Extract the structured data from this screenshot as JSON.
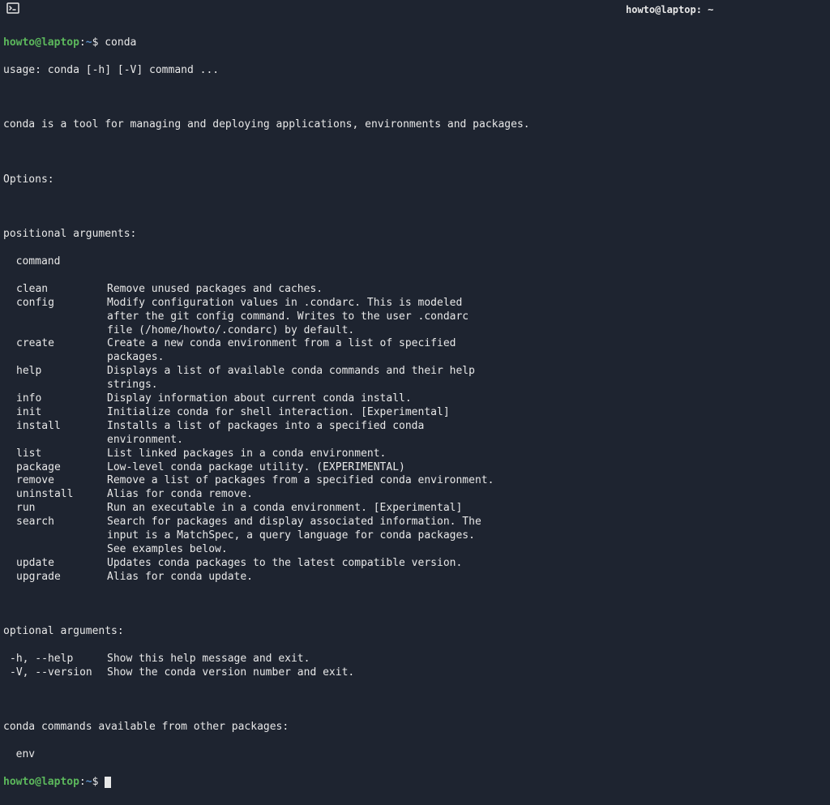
{
  "titlebar": {
    "title": "howto@laptop: ~"
  },
  "prompt": {
    "user_host": "howto@laptop",
    "separator": ":",
    "path": "~",
    "dollar": "$"
  },
  "command1": "conda",
  "usage": "usage: conda [-h] [-V] command ...",
  "description": "conda is a tool for managing and deploying applications, environments and packages.",
  "options_header": "Options:",
  "positional_header": "positional arguments:",
  "command_label": "  command",
  "positional_args": [
    {
      "name": "clean",
      "desc": [
        "Remove unused packages and caches."
      ]
    },
    {
      "name": "config",
      "desc": [
        "Modify configuration values in .condarc. This is modeled",
        "after the git config command. Writes to the user .condarc",
        "file (/home/howto/.condarc) by default."
      ]
    },
    {
      "name": "create",
      "desc": [
        "Create a new conda environment from a list of specified",
        "packages."
      ]
    },
    {
      "name": "help",
      "desc": [
        "Displays a list of available conda commands and their help",
        "strings."
      ]
    },
    {
      "name": "info",
      "desc": [
        "Display information about current conda install."
      ]
    },
    {
      "name": "init",
      "desc": [
        "Initialize conda for shell interaction. [Experimental]"
      ]
    },
    {
      "name": "install",
      "desc": [
        "Installs a list of packages into a specified conda",
        "environment."
      ]
    },
    {
      "name": "list",
      "desc": [
        "List linked packages in a conda environment."
      ]
    },
    {
      "name": "package",
      "desc": [
        "Low-level conda package utility. (EXPERIMENTAL)"
      ]
    },
    {
      "name": "remove",
      "desc": [
        "Remove a list of packages from a specified conda environment."
      ]
    },
    {
      "name": "uninstall",
      "desc": [
        "Alias for conda remove."
      ]
    },
    {
      "name": "run",
      "desc": [
        "Run an executable in a conda environment. [Experimental]"
      ]
    },
    {
      "name": "search",
      "desc": [
        "Search for packages and display associated information. The",
        "input is a MatchSpec, a query language for conda packages.",
        "See examples below."
      ]
    },
    {
      "name": "update",
      "desc": [
        "Updates conda packages to the latest compatible version."
      ]
    },
    {
      "name": "upgrade",
      "desc": [
        "Alias for conda update."
      ]
    }
  ],
  "optional_header": "optional arguments:",
  "optional_args": [
    {
      "name": "-h, --help",
      "desc": "Show this help message and exit."
    },
    {
      "name": "-V, --version",
      "desc": "Show the conda version number and exit."
    }
  ],
  "other_packages_header": "conda commands available from other packages:",
  "other_packages": [
    "  env"
  ]
}
